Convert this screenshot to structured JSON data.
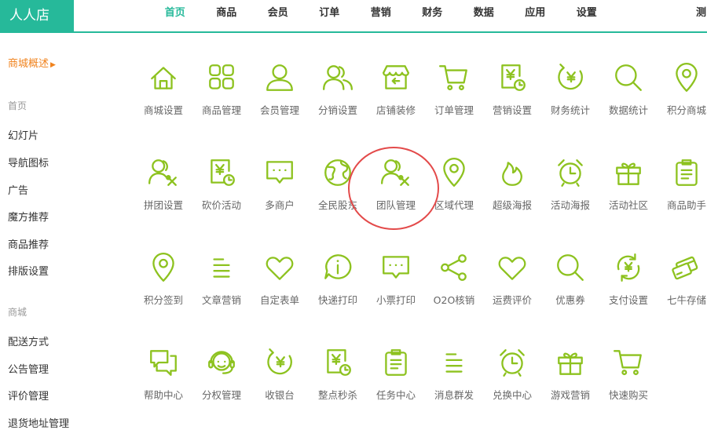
{
  "app": {
    "logo": "人人店",
    "accent": "#26b99a",
    "icon_color": "#8dc21f",
    "orange": "#f0831e"
  },
  "nav": {
    "items": [
      "首页",
      "商品",
      "会员",
      "订单",
      "营销",
      "财务",
      "数据",
      "应用",
      "设置"
    ],
    "active_index": 0,
    "extra": "测"
  },
  "sidebar": {
    "overview": "商城概述",
    "group1": "首页",
    "group1_items": [
      "幻灯片",
      "导航图标",
      "广告",
      "魔方推荐",
      "商品推荐",
      "排版设置"
    ],
    "group2": "商城",
    "group2_items": [
      "配送方式",
      "公告管理",
      "评价管理",
      "退货地址管理"
    ]
  },
  "grid": {
    "rows": [
      [
        {
          "label": "商城设置",
          "icon": "house-icon"
        },
        {
          "label": "商品管理",
          "icon": "grid-icon"
        },
        {
          "label": "会员管理",
          "icon": "user-icon"
        },
        {
          "label": "分销设置",
          "icon": "users-icon"
        },
        {
          "label": "店铺装修",
          "icon": "shop-icon"
        },
        {
          "label": "订单管理",
          "icon": "cart-icon"
        },
        {
          "label": "营销设置",
          "icon": "yen-doc-clock-icon"
        },
        {
          "label": "财务统计",
          "icon": "yen-cycle-icon"
        },
        {
          "label": "数据统计",
          "icon": "magnifier-icon"
        },
        {
          "label": "积分商城",
          "icon": "location-pin-icon"
        }
      ],
      [
        {
          "label": "拼团设置",
          "icon": "users-tool-icon"
        },
        {
          "label": "砍价活动",
          "icon": "yen-doc-clock-icon"
        },
        {
          "label": "多商户",
          "icon": "chat-dots-icon"
        },
        {
          "label": "全民股东",
          "icon": "globe-icon"
        },
        {
          "label": "团队管理",
          "icon": "users-tool-icon"
        },
        {
          "label": "区域代理",
          "icon": "location-pin-icon"
        },
        {
          "label": "超级海报",
          "icon": "flame-icon"
        },
        {
          "label": "活动海报",
          "icon": "alarm-clock-icon"
        },
        {
          "label": "活动社区",
          "icon": "gift-icon"
        },
        {
          "label": "商品助手",
          "icon": "clipboard-icon"
        }
      ],
      [
        {
          "label": "积分签到",
          "icon": "location-pin-icon"
        },
        {
          "label": "文章营销",
          "icon": "text-lines-icon"
        },
        {
          "label": "自定表单",
          "icon": "heart-icon"
        },
        {
          "label": "快递打印",
          "icon": "info-bubble-icon"
        },
        {
          "label": "小票打印",
          "icon": "chat-dots-icon"
        },
        {
          "label": "O2O核销",
          "icon": "share-icon"
        },
        {
          "label": "运费评价",
          "icon": "heart-icon"
        },
        {
          "label": "优惠券",
          "icon": "magnifier-icon"
        },
        {
          "label": "支付设置",
          "icon": "yen-refresh-icon"
        },
        {
          "label": "七牛存储",
          "icon": "cards-icon"
        }
      ],
      [
        {
          "label": "帮助中心",
          "icon": "chat-double-icon"
        },
        {
          "label": "分权管理",
          "icon": "headset-icon"
        },
        {
          "label": "收银台",
          "icon": "yen-cycle-icon"
        },
        {
          "label": "整点秒杀",
          "icon": "yen-doc-clock-icon"
        },
        {
          "label": "任务中心",
          "icon": "clipboard-icon"
        },
        {
          "label": "消息群发",
          "icon": "text-lines-icon"
        },
        {
          "label": "兑换中心",
          "icon": "alarm-clock-icon"
        },
        {
          "label": "游戏营销",
          "icon": "gift-icon"
        },
        {
          "label": "快速购买",
          "icon": "cart-icon"
        }
      ]
    ]
  }
}
